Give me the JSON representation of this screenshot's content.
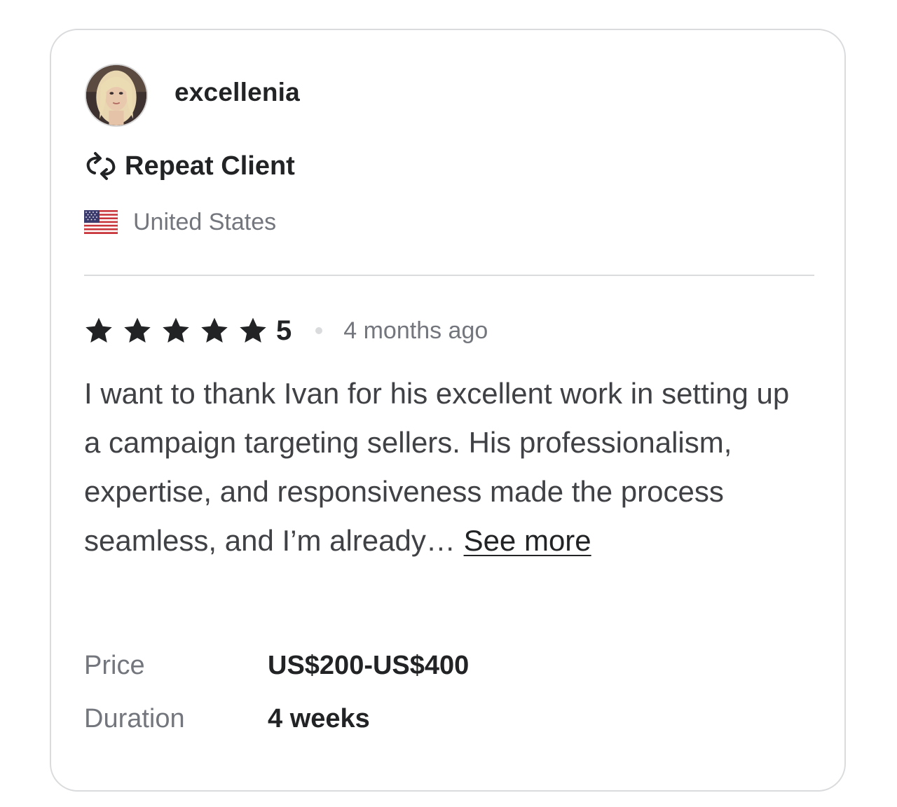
{
  "reviewer": {
    "username": "excellenia",
    "avatar_icon": "user-avatar-photo",
    "badge": {
      "icon": "repeat-icon",
      "label": "Repeat Client"
    },
    "country": {
      "flag_icon": "us-flag-icon",
      "name": "United States"
    }
  },
  "review": {
    "rating": 5,
    "rating_label": "5",
    "stars_filled": 5,
    "stars_total": 5,
    "time_ago": "4 months ago",
    "text": "I want to thank Ivan for his excellent work in setting up a campaign targeting sellers. His professionalism, expertise, and responsiveness made the process seamless, and I’m already…",
    "see_more_label": "See more"
  },
  "details": {
    "price_label": "Price",
    "price_value": "US$200-US$400",
    "duration_label": "Duration",
    "duration_value": "4 weeks"
  },
  "colors": {
    "text_primary": "#222325",
    "text_secondary": "#74767e",
    "body_text": "#404145",
    "border": "#dadbdd",
    "star": "#222325"
  }
}
